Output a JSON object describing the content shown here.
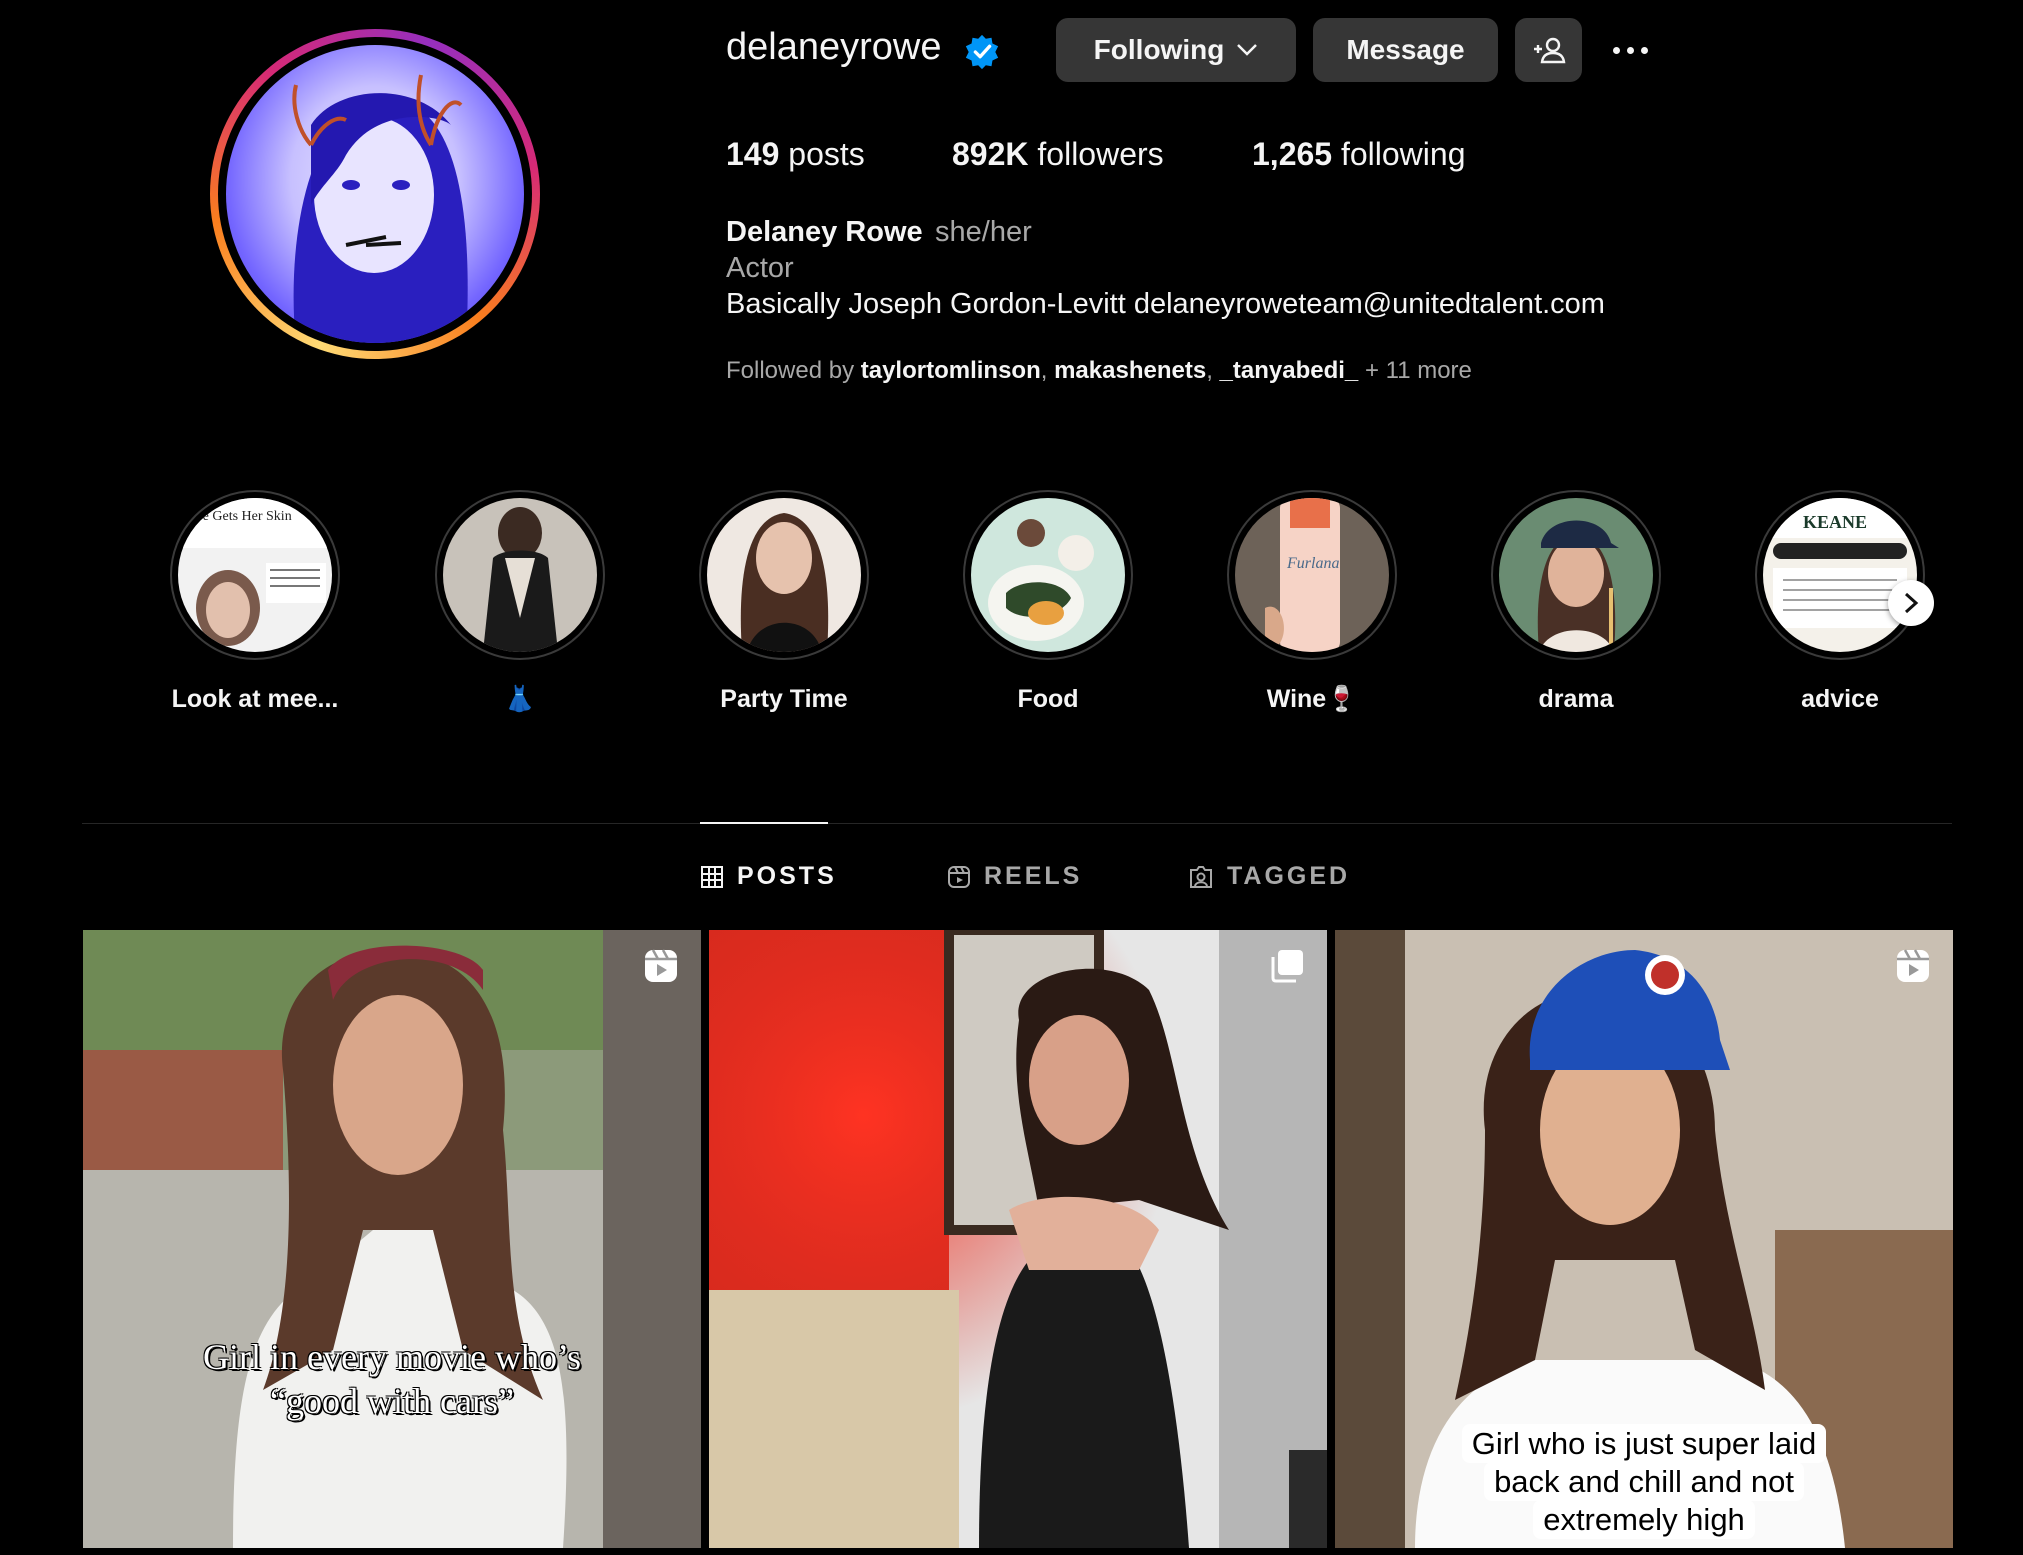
{
  "profile": {
    "username": "delaneyrowe",
    "verified": true,
    "buttons": {
      "following": "Following",
      "message": "Message"
    },
    "stats": {
      "posts_count": "149",
      "posts_label": "posts",
      "followers_count": "892K",
      "followers_label": "followers",
      "following_count": "1,265",
      "following_label": "following"
    },
    "full_name": "Delaney Rowe",
    "pronouns": "she/her",
    "category": "Actor",
    "bio": "Basically Joseph Gordon-Levitt delaneyroweteam@unitedtalent.com",
    "followed_by": {
      "prefix": "Followed by ",
      "users": [
        "taylortomlinson",
        "makashenets",
        "_tanyabedi_"
      ],
      "more": "+ 11 more"
    }
  },
  "highlights": [
    {
      "label": "Look at mee..."
    },
    {
      "label": "👗"
    },
    {
      "label": "Party Time"
    },
    {
      "label": "Food"
    },
    {
      "label": "Wine🍷"
    },
    {
      "label": "drama"
    },
    {
      "label": "advice"
    }
  ],
  "tabs": [
    {
      "label": "POSTS",
      "icon": "grid-icon",
      "active": true
    },
    {
      "label": "REELS",
      "icon": "reels-icon",
      "active": false
    },
    {
      "label": "TAGGED",
      "icon": "tagged-icon",
      "active": false
    }
  ],
  "posts": [
    {
      "type": "reel",
      "caption_line1": "Girl in every movie who’s",
      "caption_line2": "“good with cars”"
    },
    {
      "type": "carousel"
    },
    {
      "type": "reel",
      "caption": "Girl who is just super laid back and chill and not extremely high"
    }
  ],
  "colors": {
    "background": "#000000",
    "button_bg": "#363636",
    "verified_blue": "#0095f6",
    "secondary_text": "#a8a8a8"
  }
}
